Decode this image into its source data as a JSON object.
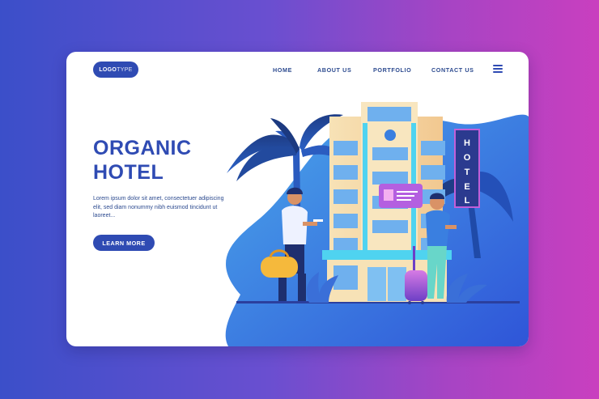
{
  "header": {
    "logo": {
      "bold": "LOGO",
      "thin": "TYPE"
    },
    "nav": [
      {
        "label": "HOME"
      },
      {
        "label": "ABOUT US"
      },
      {
        "label": "PORTFOLIO"
      },
      {
        "label": "CONTACT US"
      }
    ],
    "menu_icon": "hamburger-menu-icon"
  },
  "hero": {
    "title_line1": "ORGANIC",
    "title_line2": "HOTEL",
    "description": "Lorem ipsum dolor sit amet, consectetuer adipiscing elit, sed diam nonummy nibh euismod tincidunt ut laoreet...",
    "cta_label": "LEARN MORE"
  },
  "illustration": {
    "sign_text": "HOTEL",
    "icons": [
      "palm-tree-icon",
      "hotel-building-icon",
      "hotel-sign-icon",
      "traveler-man-icon",
      "traveler-woman-icon",
      "suitcase-icon",
      "duffel-bag-icon",
      "review-bubble-icon"
    ]
  },
  "colors": {
    "primary": "#2f4bb3",
    "text": "#2c4a8f",
    "bg_left": "#3b4fc9",
    "bg_right": "#c93fbf",
    "building": "#f6dfb0",
    "accent_cyan": "#4fd3f0"
  }
}
